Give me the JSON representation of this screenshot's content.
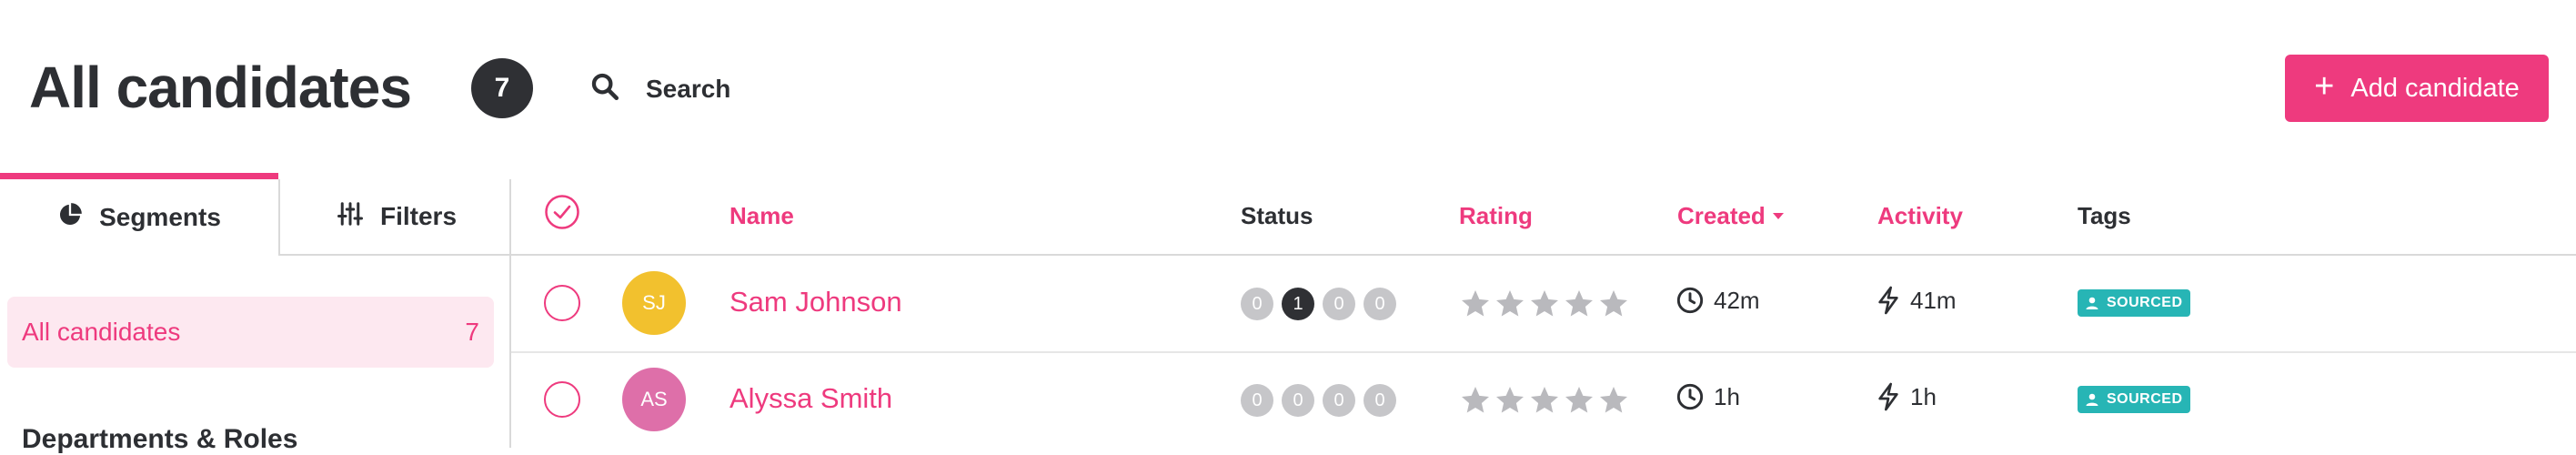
{
  "header": {
    "title": "All candidates",
    "count": "7",
    "search_label": "Search",
    "add_button_label": "Add candidate"
  },
  "sidebar": {
    "tabs": [
      {
        "label": "Segments",
        "icon": "pie-chart-icon",
        "active": true
      },
      {
        "label": "Filters",
        "icon": "sliders-icon",
        "active": false
      }
    ],
    "segments": [
      {
        "label": "All candidates",
        "count": "7",
        "selected": true
      }
    ],
    "section_heading": "Departments & Roles"
  },
  "table": {
    "columns": {
      "name": "Name",
      "status": "Status",
      "rating": "Rating",
      "created": "Created",
      "activity": "Activity",
      "tags": "Tags"
    },
    "rows": [
      {
        "initials": "SJ",
        "avatar_color": "#f2c12e",
        "name": "Sam Johnson",
        "stages": [
          "0",
          "1",
          "0",
          "0"
        ],
        "active_stage": 1,
        "rating": 0,
        "created": "42m",
        "activity": "41m",
        "tag": "SOURCED"
      },
      {
        "initials": "AS",
        "avatar_color": "#de6fa9",
        "name": "Alyssa Smith",
        "stages": [
          "0",
          "0",
          "0",
          "0"
        ],
        "active_stage": -1,
        "rating": 0,
        "created": "1h",
        "activity": "1h",
        "tag": "SOURCED"
      }
    ]
  },
  "colors": {
    "accent": "#ee3a7e",
    "dark": "#2f3034",
    "tag_teal": "#27b5b5",
    "stage_inactive": "#c6c6c9",
    "star_empty": "#b9b9bd"
  }
}
